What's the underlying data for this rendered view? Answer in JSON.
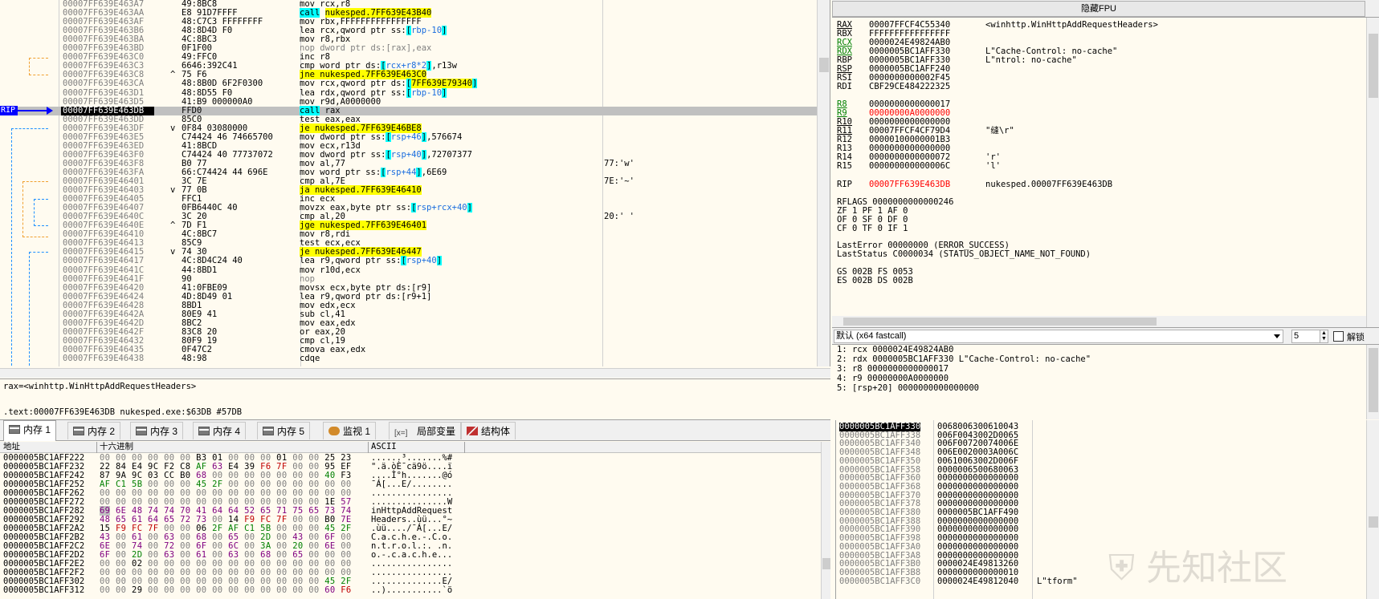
{
  "disasm": {
    "rows": [
      {
        "addr": "00007FF639E463A7",
        "jmp": "",
        "bytes": "49:8BC8",
        "instr": [
          {
            "t": "mov rcx,r8"
          }
        ],
        "cmt": ""
      },
      {
        "addr": "00007FF639E463AA",
        "jmp": "",
        "bytes": "E8 91D7FFFF",
        "instr": [
          {
            "t": "call",
            "c": "hl-call"
          },
          {
            "t": " "
          },
          {
            "t": "nukesped.7FF639E43B40",
            "c": "hl-jmp"
          }
        ],
        "cmt": ""
      },
      {
        "addr": "00007FF639E463AF",
        "jmp": "",
        "bytes": "48:C7C3 FFFFFFFF",
        "instr": [
          {
            "t": "mov rbx,FFFFFFFFFFFFFFFF"
          }
        ],
        "cmt": ""
      },
      {
        "addr": "00007FF639E463B6",
        "jmp": "",
        "bytes": "48:8D4D F0",
        "instr": [
          {
            "t": "lea rcx,"
          },
          {
            "t": "qword ptr ss:"
          },
          {
            "t": "[",
            "c": "op-bracket"
          },
          {
            "t": "rbp-10",
            "c": "op-reg-in"
          },
          {
            "t": "]",
            "c": "op-bracket"
          }
        ],
        "cmt": ""
      },
      {
        "addr": "00007FF639E463BA",
        "jmp": "",
        "bytes": "4C:8BC3",
        "instr": [
          {
            "t": "mov r8,rbx"
          }
        ],
        "cmt": ""
      },
      {
        "addr": "00007FF639E463BD",
        "jmp": "",
        "bytes": "0F1F00",
        "instr": [
          {
            "t": "nop dword ptr ds:[rax],eax",
            "c": "mnem-nop"
          }
        ],
        "cmt": ""
      },
      {
        "addr": "00007FF639E463C0",
        "jmp": "",
        "bytes": "49:FFC0",
        "instr": [
          {
            "t": "inc r8"
          }
        ],
        "cmt": ""
      },
      {
        "addr": "00007FF639E463C3",
        "jmp": "",
        "bytes": "6646:392C41",
        "instr": [
          {
            "t": "cmp word ptr ds:"
          },
          {
            "t": "[",
            "c": "op-bracket"
          },
          {
            "t": "rcx+r8*2",
            "c": "op-reg-in"
          },
          {
            "t": "]",
            "c": "op-bracket"
          },
          {
            "t": ",r13w"
          }
        ],
        "cmt": ""
      },
      {
        "addr": "00007FF639E463C8",
        "jmp": "^",
        "bytes": "75 F6",
        "instr": [
          {
            "t": "jne nukesped.7FF639E463C0",
            "c": "hl-jmp"
          }
        ],
        "cmt": ""
      },
      {
        "addr": "00007FF639E463CA",
        "jmp": "",
        "bytes": "48:8B0D 6F2F0300",
        "instr": [
          {
            "t": "mov rcx,qword ptr ds:"
          },
          {
            "t": "[",
            "c": "op-bracket"
          },
          {
            "t": "7FF639E79340",
            "c": "hl-jmp"
          },
          {
            "t": "]",
            "c": "op-bracket"
          }
        ],
        "cmt": ""
      },
      {
        "addr": "00007FF639E463D1",
        "jmp": "",
        "bytes": "48:8D55 F0",
        "instr": [
          {
            "t": "lea rdx,qword ptr ss:"
          },
          {
            "t": "[",
            "c": "op-bracket"
          },
          {
            "t": "rbp-10",
            "c": "op-reg-in"
          },
          {
            "t": "]",
            "c": "op-bracket"
          }
        ],
        "cmt": ""
      },
      {
        "addr": "00007FF639E463D5",
        "jmp": "",
        "bytes": "41:B9 000000A0",
        "instr": [
          {
            "t": "mov r9d,A0000000"
          }
        ],
        "cmt": ""
      },
      {
        "addr": "00007FF639E463DB",
        "jmp": "",
        "bytes": "FFD0",
        "instr": [
          {
            "t": "call",
            "c": "hl-call"
          },
          {
            "t": " rax"
          }
        ],
        "cmt": "",
        "cur": true
      },
      {
        "addr": "00007FF639E463DD",
        "jmp": "",
        "bytes": "85C0",
        "instr": [
          {
            "t": "test eax,eax"
          }
        ],
        "cmt": ""
      },
      {
        "addr": "00007FF639E463DF",
        "jmp": "v",
        "bytes": "0F84 03080000",
        "instr": [
          {
            "t": "je nukesped.7FF639E46BE8",
            "c": "hl-jmp"
          }
        ],
        "cmt": ""
      },
      {
        "addr": "00007FF639E463E5",
        "jmp": "",
        "bytes": "C74424 46 74665700",
        "instr": [
          {
            "t": "mov dword ptr ss:"
          },
          {
            "t": "[",
            "c": "op-bracket"
          },
          {
            "t": "rsp+46",
            "c": "op-reg-in"
          },
          {
            "t": "]",
            "c": "op-bracket"
          },
          {
            "t": ",576674"
          }
        ],
        "cmt": ""
      },
      {
        "addr": "00007FF639E463ED",
        "jmp": "",
        "bytes": "41:8BCD",
        "instr": [
          {
            "t": "mov ecx,r13d"
          }
        ],
        "cmt": ""
      },
      {
        "addr": "00007FF639E463F0",
        "jmp": "",
        "bytes": "C74424 40 77737072",
        "instr": [
          {
            "t": "mov dword ptr ss:"
          },
          {
            "t": "[",
            "c": "op-bracket"
          },
          {
            "t": "rsp+40",
            "c": "op-reg-in"
          },
          {
            "t": "]",
            "c": "op-bracket"
          },
          {
            "t": ",72707377"
          }
        ],
        "cmt": ""
      },
      {
        "addr": "00007FF639E463F8",
        "jmp": "",
        "bytes": "B0 77",
        "instr": [
          {
            "t": "mov al,77"
          }
        ],
        "cmt": "77:'w'"
      },
      {
        "addr": "00007FF639E463FA",
        "jmp": "",
        "bytes": "66:C74424 44 696E",
        "instr": [
          {
            "t": "mov word ptr ss:"
          },
          {
            "t": "[",
            "c": "op-bracket"
          },
          {
            "t": "rsp+44",
            "c": "op-reg-in"
          },
          {
            "t": "]",
            "c": "op-bracket"
          },
          {
            "t": ",6E69"
          }
        ],
        "cmt": ""
      },
      {
        "addr": "00007FF639E46401",
        "jmp": "",
        "bytes": "3C 7E",
        "instr": [
          {
            "t": "cmp al,7E"
          }
        ],
        "cmt": "7E:'~'"
      },
      {
        "addr": "00007FF639E46403",
        "jmp": "v",
        "bytes": "77 0B",
        "instr": [
          {
            "t": "ja nukesped.7FF639E46410",
            "c": "hl-jmp"
          }
        ],
        "cmt": ""
      },
      {
        "addr": "00007FF639E46405",
        "jmp": "",
        "bytes": "FFC1",
        "instr": [
          {
            "t": "inc ecx"
          }
        ],
        "cmt": ""
      },
      {
        "addr": "00007FF639E46407",
        "jmp": "",
        "bytes": "0FB6440C 40",
        "instr": [
          {
            "t": "movzx eax,byte ptr ss:"
          },
          {
            "t": "[",
            "c": "op-bracket"
          },
          {
            "t": "rsp+rcx+40",
            "c": "op-reg-in"
          },
          {
            "t": "]",
            "c": "op-bracket"
          }
        ],
        "cmt": ""
      },
      {
        "addr": "00007FF639E4640C",
        "jmp": "",
        "bytes": "3C 20",
        "instr": [
          {
            "t": "cmp al,20"
          }
        ],
        "cmt": "20:' '"
      },
      {
        "addr": "00007FF639E4640E",
        "jmp": "^",
        "bytes": "7D F1",
        "instr": [
          {
            "t": "jge nukesped.7FF639E46401",
            "c": "hl-jmp"
          }
        ],
        "cmt": ""
      },
      {
        "addr": "00007FF639E46410",
        "jmp": "",
        "bytes": "4C:8BC7",
        "instr": [
          {
            "t": "mov r8,rdi"
          }
        ],
        "cmt": ""
      },
      {
        "addr": "00007FF639E46413",
        "jmp": "",
        "bytes": "85C9",
        "instr": [
          {
            "t": "test ecx,ecx"
          }
        ],
        "cmt": ""
      },
      {
        "addr": "00007FF639E46415",
        "jmp": "v",
        "bytes": "74 30",
        "instr": [
          {
            "t": "je nukesped.7FF639E46447",
            "c": "hl-jmp"
          }
        ],
        "cmt": ""
      },
      {
        "addr": "00007FF639E46417",
        "jmp": "",
        "bytes": "4C:8D4C24 40",
        "instr": [
          {
            "t": "lea r9,qword ptr ss:"
          },
          {
            "t": "[",
            "c": "op-bracket"
          },
          {
            "t": "rsp+40",
            "c": "op-reg-in"
          },
          {
            "t": "]",
            "c": "op-bracket"
          }
        ],
        "cmt": ""
      },
      {
        "addr": "00007FF639E4641C",
        "jmp": "",
        "bytes": "44:8BD1",
        "instr": [
          {
            "t": "mov r10d,ecx"
          }
        ],
        "cmt": ""
      },
      {
        "addr": "00007FF639E4641F",
        "jmp": "",
        "bytes": "90",
        "instr": [
          {
            "t": "nop",
            "c": "mnem-nop"
          }
        ],
        "cmt": ""
      },
      {
        "addr": "00007FF639E46420",
        "jmp": "",
        "bytes": "41:0FBE09",
        "instr": [
          {
            "t": "movsx ecx,byte ptr ds:[r9]"
          }
        ],
        "cmt": ""
      },
      {
        "addr": "00007FF639E46424",
        "jmp": "",
        "bytes": "4D:8D49 01",
        "instr": [
          {
            "t": "lea r9,qword ptr ds:[r9+1]"
          }
        ],
        "cmt": ""
      },
      {
        "addr": "00007FF639E46428",
        "jmp": "",
        "bytes": "8BD1",
        "instr": [
          {
            "t": "mov edx,ecx"
          }
        ],
        "cmt": ""
      },
      {
        "addr": "00007FF639E4642A",
        "jmp": "",
        "bytes": "80E9 41",
        "instr": [
          {
            "t": "sub cl,41"
          }
        ],
        "cmt": ""
      },
      {
        "addr": "00007FF639E4642D",
        "jmp": "",
        "bytes": "8BC2",
        "instr": [
          {
            "t": "mov eax,edx"
          }
        ],
        "cmt": ""
      },
      {
        "addr": "00007FF639E4642F",
        "jmp": "",
        "bytes": "83C8 20",
        "instr": [
          {
            "t": "or eax,20"
          }
        ],
        "cmt": ""
      },
      {
        "addr": "00007FF639E46432",
        "jmp": "",
        "bytes": "80F9 19",
        "instr": [
          {
            "t": "cmp cl,19"
          }
        ],
        "cmt": ""
      },
      {
        "addr": "00007FF639E46435",
        "jmp": "",
        "bytes": "0F47C2",
        "instr": [
          {
            "t": "cmova eax,edx"
          }
        ],
        "cmt": ""
      },
      {
        "addr": "00007FF639E46438",
        "jmp": "",
        "bytes": "48:98",
        "instr": [
          {
            "t": "cdqe"
          }
        ],
        "cmt": ""
      }
    ],
    "rip_label": "RIP"
  },
  "info": {
    "line1": "rax=<winhttp.WinHttpAddRequestHeaders>",
    "line2": ".text:00007FF639E463DB nukesped.exe:$63DB #57DB"
  },
  "regs": {
    "hide_fpu_label": "隐藏FPU",
    "gp": [
      {
        "n": "RAX",
        "v": "00007FFCF4C55340",
        "c": "<winhttp.WinHttpAddRequestHeaders>",
        "u": true
      },
      {
        "n": "RBX",
        "v": "FFFFFFFFFFFFFFFF",
        "c": ""
      },
      {
        "n": "RCX",
        "v": "0000024E49824AB0",
        "c": "",
        "u": true,
        "green": true
      },
      {
        "n": "RDX",
        "v": "0000005BC1AFF330",
        "c": "L\"Cache-Control: no-cache\"",
        "u": true,
        "green": true
      },
      {
        "n": "RBP",
        "v": "0000005BC1AFF330",
        "c": "L\"ntrol: no-cache\""
      },
      {
        "n": "RSP",
        "v": "0000005BC1AFF240",
        "c": "",
        "u": true
      },
      {
        "n": "RSI",
        "v": "0000000000002F45",
        "c": ""
      },
      {
        "n": "RDI",
        "v": "CBF29CE484222325",
        "c": ""
      }
    ],
    "ext": [
      {
        "n": "R8",
        "v": "0000000000000017",
        "c": "",
        "u": true,
        "green": true
      },
      {
        "n": "R9",
        "v": "00000000A0000000",
        "c": "",
        "u": true,
        "green": true,
        "red": true
      },
      {
        "n": "R10",
        "v": "0000000000000000",
        "c": "",
        "u": true
      },
      {
        "n": "R11",
        "v": "00007FFCF4CF79D4",
        "c": "\"缝\\r\"",
        "u": true
      },
      {
        "n": "R12",
        "v": "00000100000001B3",
        "c": ""
      },
      {
        "n": "R13",
        "v": "0000000000000000",
        "c": ""
      },
      {
        "n": "R14",
        "v": "0000000000000072",
        "c": "'r'"
      },
      {
        "n": "R15",
        "v": "000000000000006C",
        "c": "'l'"
      }
    ],
    "rip": {
      "n": "RIP",
      "v": "00007FF639E463DB",
      "c": "nukesped.00007FF639E463DB"
    },
    "rflags": "RFLAGS   0000000000000246",
    "flags": [
      "ZF 1  PF 1  AF 0",
      "OF 0  SF 0  DF 0",
      "CF 0  TF 0  IF 1"
    ],
    "lasterror": "LastError  00000000 (ERROR_SUCCESS)",
    "laststatus": "LastStatus C0000034 (STATUS_OBJECT_NAME_NOT_FOUND)",
    "seg1": "GS 002B  FS 0053",
    "seg2": "ES 002B  DS 002B"
  },
  "callconv": {
    "selected": "默认 (x64 fastcall)",
    "count": "5",
    "unlock_label": "解锁",
    "args": [
      "1: rcx 0000024E49824AB0",
      "2: rdx 0000005BC1AFF330 L\"Cache-Control: no-cache\"",
      "3: r8 0000000000000017",
      "4: r9 00000000A0000000",
      "5: [rsp+20] 0000000000000000"
    ]
  },
  "tabs": [
    {
      "label": "内存 1",
      "icon": "memory-icon",
      "active": true
    },
    {
      "label": "内存 2",
      "icon": "memory-icon"
    },
    {
      "label": "内存 3",
      "icon": "memory-icon"
    },
    {
      "label": "内存 4",
      "icon": "memory-icon"
    },
    {
      "label": "内存 5",
      "icon": "memory-icon"
    },
    {
      "label": "监视 1",
      "icon": "watch-icon"
    },
    {
      "label": "局部变量",
      "icon": "locals-icon",
      "prefix": "[x=]"
    },
    {
      "label": "结构体",
      "icon": "struct-icon"
    }
  ],
  "dump": {
    "col_addr": "地址",
    "col_hex": "十六进制",
    "col_ascii": "ASCII",
    "rows": [
      {
        "a": "0000005BC1AFF222",
        "h": "00 00 00 00 00 00 B3 01 00 00 00 01 00 00 25 23",
        "x": "......³.......%#"
      },
      {
        "a": "0000005BC1AFF232",
        "h": "22 84 E4 9C F2 C8 AF 63 E4 39 F6 7F 00 00 95 EF",
        "x": "\".ä.òÈ¯cä9ö....ï"
      },
      {
        "a": "0000005BC1AFF242",
        "h": "87 9A 9C 03 CC B0 68 00 00 00 00 00 00 00 40 F3",
        "x": "....Ì°h.......@ó"
      },
      {
        "a": "0000005BC1AFF252",
        "h": "AF C1 5B 00 00 00 45 2F 00 00 00 00 00 00 00 00",
        "x": "¯Á[...E/........"
      },
      {
        "a": "0000005BC1AFF262",
        "h": "00 00 00 00 00 00 00 00 00 00 00 00 00 00 00 00",
        "x": "................"
      },
      {
        "a": "0000005BC1AFF272",
        "h": "00 00 00 00 00 00 00 00 00 00 00 00 00 00 1E 57",
        "x": "...............W"
      },
      {
        "a": "0000005BC1AFF282",
        "h": "69 6E 48 74 74 70 41 64 64 52 65 71 75 65 73 74",
        "x": "inHttpAddRequest",
        "sel": true
      },
      {
        "a": "0000005BC1AFF292",
        "h": "48 65 61 64 65 72 73 00 14 F9 FC 7F 00 00 B0 7E",
        "x": "Headers..ùü...°~"
      },
      {
        "a": "0000005BC1AFF2A2",
        "h": "15 F9 FC 7F 00 00 06 2F AF C1 5B 00 00 00 45 2F",
        "x": ".ùü..../¯Á[...E/"
      },
      {
        "a": "0000005BC1AFF2B2",
        "h": "43 00 61 00 63 00 68 00 65 00 2D 00 43 00 6F 00",
        "x": "C.a.c.h.e.-.C.o."
      },
      {
        "a": "0000005BC1AFF2C2",
        "h": "6E 00 74 00 72 00 6F 00 6C 00 3A 00 20 00 6E 00",
        "x": "n.t.r.o.l.:. .n."
      },
      {
        "a": "0000005BC1AFF2D2",
        "h": "6F 00 2D 00 63 00 61 00 63 00 68 00 65 00 00 00",
        "x": "o.-.c.a.c.h.e..."
      },
      {
        "a": "0000005BC1AFF2E2",
        "h": "00 00 02 00 00 00 00 00 00 00 00 00 00 00 00 00",
        "x": "................"
      },
      {
        "a": "0000005BC1AFF2F2",
        "h": "00 00 00 00 00 00 00 00 00 00 00 00 00 00 00 00",
        "x": "................"
      },
      {
        "a": "0000005BC1AFF302",
        "h": "00 00 00 00 00 00 00 00 00 00 00 00 00 00 45 2F",
        "x": "..............E/"
      },
      {
        "a": "0000005BC1AFF312",
        "h": "00 00 29 00 00 00 00 00 00 00 00 00 00 00 60 F6",
        "x": "..)...........`ö"
      }
    ]
  },
  "stack": {
    "rows": [
      {
        "a": "0000005BC1AFF330",
        "v": "0068006300610043",
        "c": "",
        "top": true
      },
      {
        "a": "0000005BC1AFF338",
        "v": "006F0043002D0065",
        "c": ""
      },
      {
        "a": "0000005BC1AFF340",
        "v": "006F00720074006E",
        "c": ""
      },
      {
        "a": "0000005BC1AFF348",
        "v": "006E0020003A006C",
        "c": ""
      },
      {
        "a": "0000005BC1AFF350",
        "v": "00610063002D006F",
        "c": ""
      },
      {
        "a": "0000005BC1AFF358",
        "v": "0000006500680063",
        "c": ""
      },
      {
        "a": "0000005BC1AFF360",
        "v": "0000000000000000",
        "c": ""
      },
      {
        "a": "0000005BC1AFF368",
        "v": "0000000000000000",
        "c": ""
      },
      {
        "a": "0000005BC1AFF370",
        "v": "0000000000000000",
        "c": ""
      },
      {
        "a": "0000005BC1AFF378",
        "v": "0000000000000000",
        "c": ""
      },
      {
        "a": "0000005BC1AFF380",
        "v": "0000005BC1AFF490",
        "c": ""
      },
      {
        "a": "0000005BC1AFF388",
        "v": "0000000000000000",
        "c": ""
      },
      {
        "a": "0000005BC1AFF390",
        "v": "0000000000000000",
        "c": ""
      },
      {
        "a": "0000005BC1AFF398",
        "v": "0000000000000000",
        "c": ""
      },
      {
        "a": "0000005BC1AFF3A0",
        "v": "0000000000000000",
        "c": ""
      },
      {
        "a": "0000005BC1AFF3A8",
        "v": "0000000000000000",
        "c": ""
      },
      {
        "a": "0000005BC1AFF3B0",
        "v": "0000024E49813260",
        "c": ""
      },
      {
        "a": "0000005BC1AFF3B8",
        "v": "0000000000000010",
        "c": ""
      },
      {
        "a": "0000005BC1AFF3C0",
        "v": "0000024E49812040",
        "c": "L\"tform\""
      }
    ]
  },
  "watermark": "先知社区"
}
